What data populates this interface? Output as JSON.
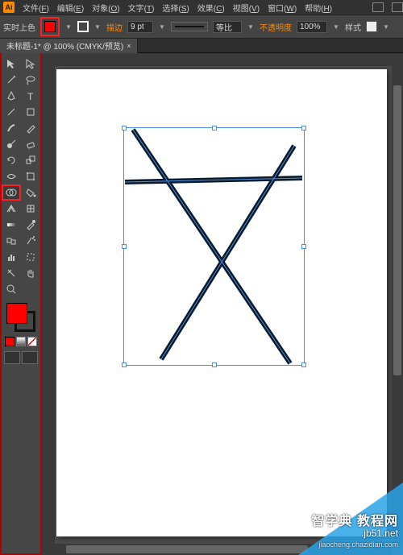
{
  "app": {
    "logo_text": "Ai"
  },
  "menu": {
    "file": {
      "label": "文件",
      "key": "F"
    },
    "edit": {
      "label": "编辑",
      "key": "E"
    },
    "object": {
      "label": "对象",
      "key": "O"
    },
    "type": {
      "label": "文字",
      "key": "T"
    },
    "select": {
      "label": "选择",
      "key": "S"
    },
    "effect": {
      "label": "效果",
      "key": "C"
    },
    "view": {
      "label": "视图",
      "key": "V"
    },
    "window": {
      "label": "窗口",
      "key": "W"
    },
    "help": {
      "label": "帮助",
      "key": "H"
    }
  },
  "control": {
    "label_fill": "实时上色",
    "stroke_label": "描边",
    "stroke_value": "9 pt",
    "stroke_style": "等比",
    "opacity_label": "不透明度",
    "opacity_value": "100%",
    "style_label": "样式"
  },
  "tab": {
    "title": "未标题-1* @ 100% (CMYK/预览)",
    "close": "×"
  },
  "tooltips": {
    "selection": "selection",
    "direct": "direct-selection",
    "wand": "magic-wand",
    "lasso": "lasso",
    "pen": "pen",
    "type": "type",
    "line": "line",
    "rect": "rectangle",
    "brush": "paintbrush",
    "pencil": "pencil",
    "blob": "blob-brush",
    "eraser": "eraser",
    "rotate": "rotate",
    "scale": "scale",
    "width": "width",
    "warp": "free-transform",
    "shapebuilder": "shape-builder",
    "livepaint": "live-paint-bucket",
    "perspective": "perspective-grid",
    "mesh": "mesh",
    "gradient": "gradient",
    "eyedrop": "eyedropper",
    "blend": "blend",
    "symbol": "symbol-sprayer",
    "graph": "column-graph",
    "artboard": "artboard",
    "slice": "slice",
    "hand": "hand",
    "zoom": "zoom"
  },
  "colors": {
    "fill": "#ff0000",
    "stroke": "#000000",
    "accent_highlight": "#ff2020",
    "selection": "#4a90e2"
  },
  "watermark": {
    "line1": "智学典  教程网",
    "line2": ".jb51.net",
    "line3": "jiaocheng.chazidian.com"
  }
}
